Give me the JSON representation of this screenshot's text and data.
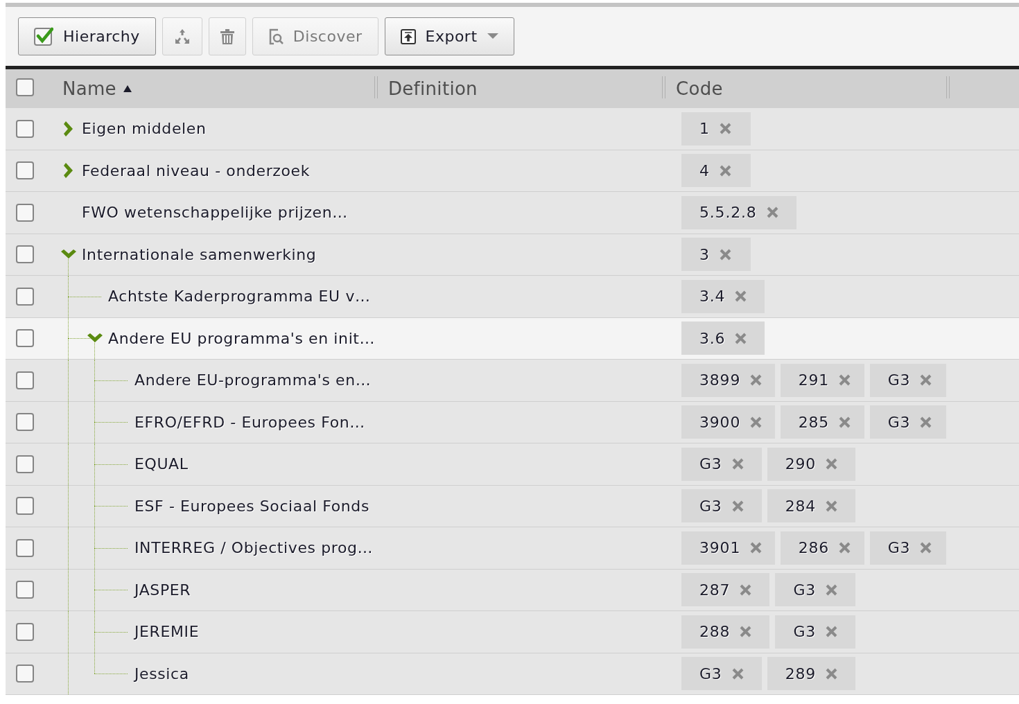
{
  "toolbar": [
    {
      "kind": "toggle",
      "label": "Hierarchy",
      "checked": true,
      "disabled": false
    },
    {
      "kind": "spread",
      "disabled": true
    },
    {
      "kind": "trash",
      "disabled": true
    },
    {
      "kind": "discover",
      "label": "Discover",
      "disabled": true
    },
    {
      "kind": "export",
      "label": "Export",
      "disabled": false
    }
  ],
  "table": {
    "select_all": {
      "checked": false
    },
    "columns": [
      {
        "label": "Name",
        "sorted": true
      },
      {
        "label": "Definition"
      },
      {
        "label": "Code"
      }
    ],
    "rows": [
      {
        "name": "Eigen middelen",
        "checked": false,
        "highlighted": false,
        "expanded": false,
        "codes": [
          "1"
        ]
      },
      {
        "name": "Federaal niveau - onderzoek",
        "checked": false,
        "highlighted": false,
        "expanded": false,
        "codes": [
          "4"
        ]
      },
      {
        "name": "FWO wetenschappelijke prijzen…",
        "checked": false,
        "highlighted": false,
        "codes": [
          "5.5.2.8"
        ]
      },
      {
        "name": "Internationale samenwerking",
        "checked": false,
        "highlighted": false,
        "expanded": true,
        "codes": [
          "3"
        ],
        "children": [
          {
            "name": "Achtste Kaderprogramma EU v…",
            "checked": false,
            "highlighted": false,
            "codes": [
              "3.4"
            ]
          },
          {
            "name": "Andere EU programma's en init…",
            "checked": false,
            "highlighted": true,
            "expanded": true,
            "codes": [
              "3.6"
            ],
            "children": [
              {
                "name": "Andere EU-programma's en…",
                "checked": false,
                "highlighted": false,
                "codes": [
                  "3899",
                  "291",
                  "G3"
                ]
              },
              {
                "name": "EFRO/EFRD - Europees Fon…",
                "checked": false,
                "highlighted": false,
                "codes": [
                  "3900",
                  "285",
                  "G3"
                ]
              },
              {
                "name": "EQUAL",
                "checked": false,
                "highlighted": false,
                "codes": [
                  "G3",
                  "290"
                ]
              },
              {
                "name": "ESF - Europees Sociaal Fonds",
                "checked": false,
                "highlighted": false,
                "codes": [
                  "G3",
                  "284"
                ]
              },
              {
                "name": "INTERREG / Objectives prog…",
                "checked": false,
                "highlighted": false,
                "codes": [
                  "3901",
                  "286",
                  "G3"
                ]
              },
              {
                "name": "JASPER",
                "checked": false,
                "highlighted": false,
                "codes": [
                  "287",
                  "G3"
                ]
              },
              {
                "name": "JEREMIE",
                "checked": false,
                "highlighted": false,
                "codes": [
                  "288",
                  "G3"
                ]
              },
              {
                "name": "Jessica",
                "checked": false,
                "highlighted": false,
                "codes": [
                  "G3",
                  "289"
                ]
              }
            ]
          }
        ]
      }
    ]
  }
}
